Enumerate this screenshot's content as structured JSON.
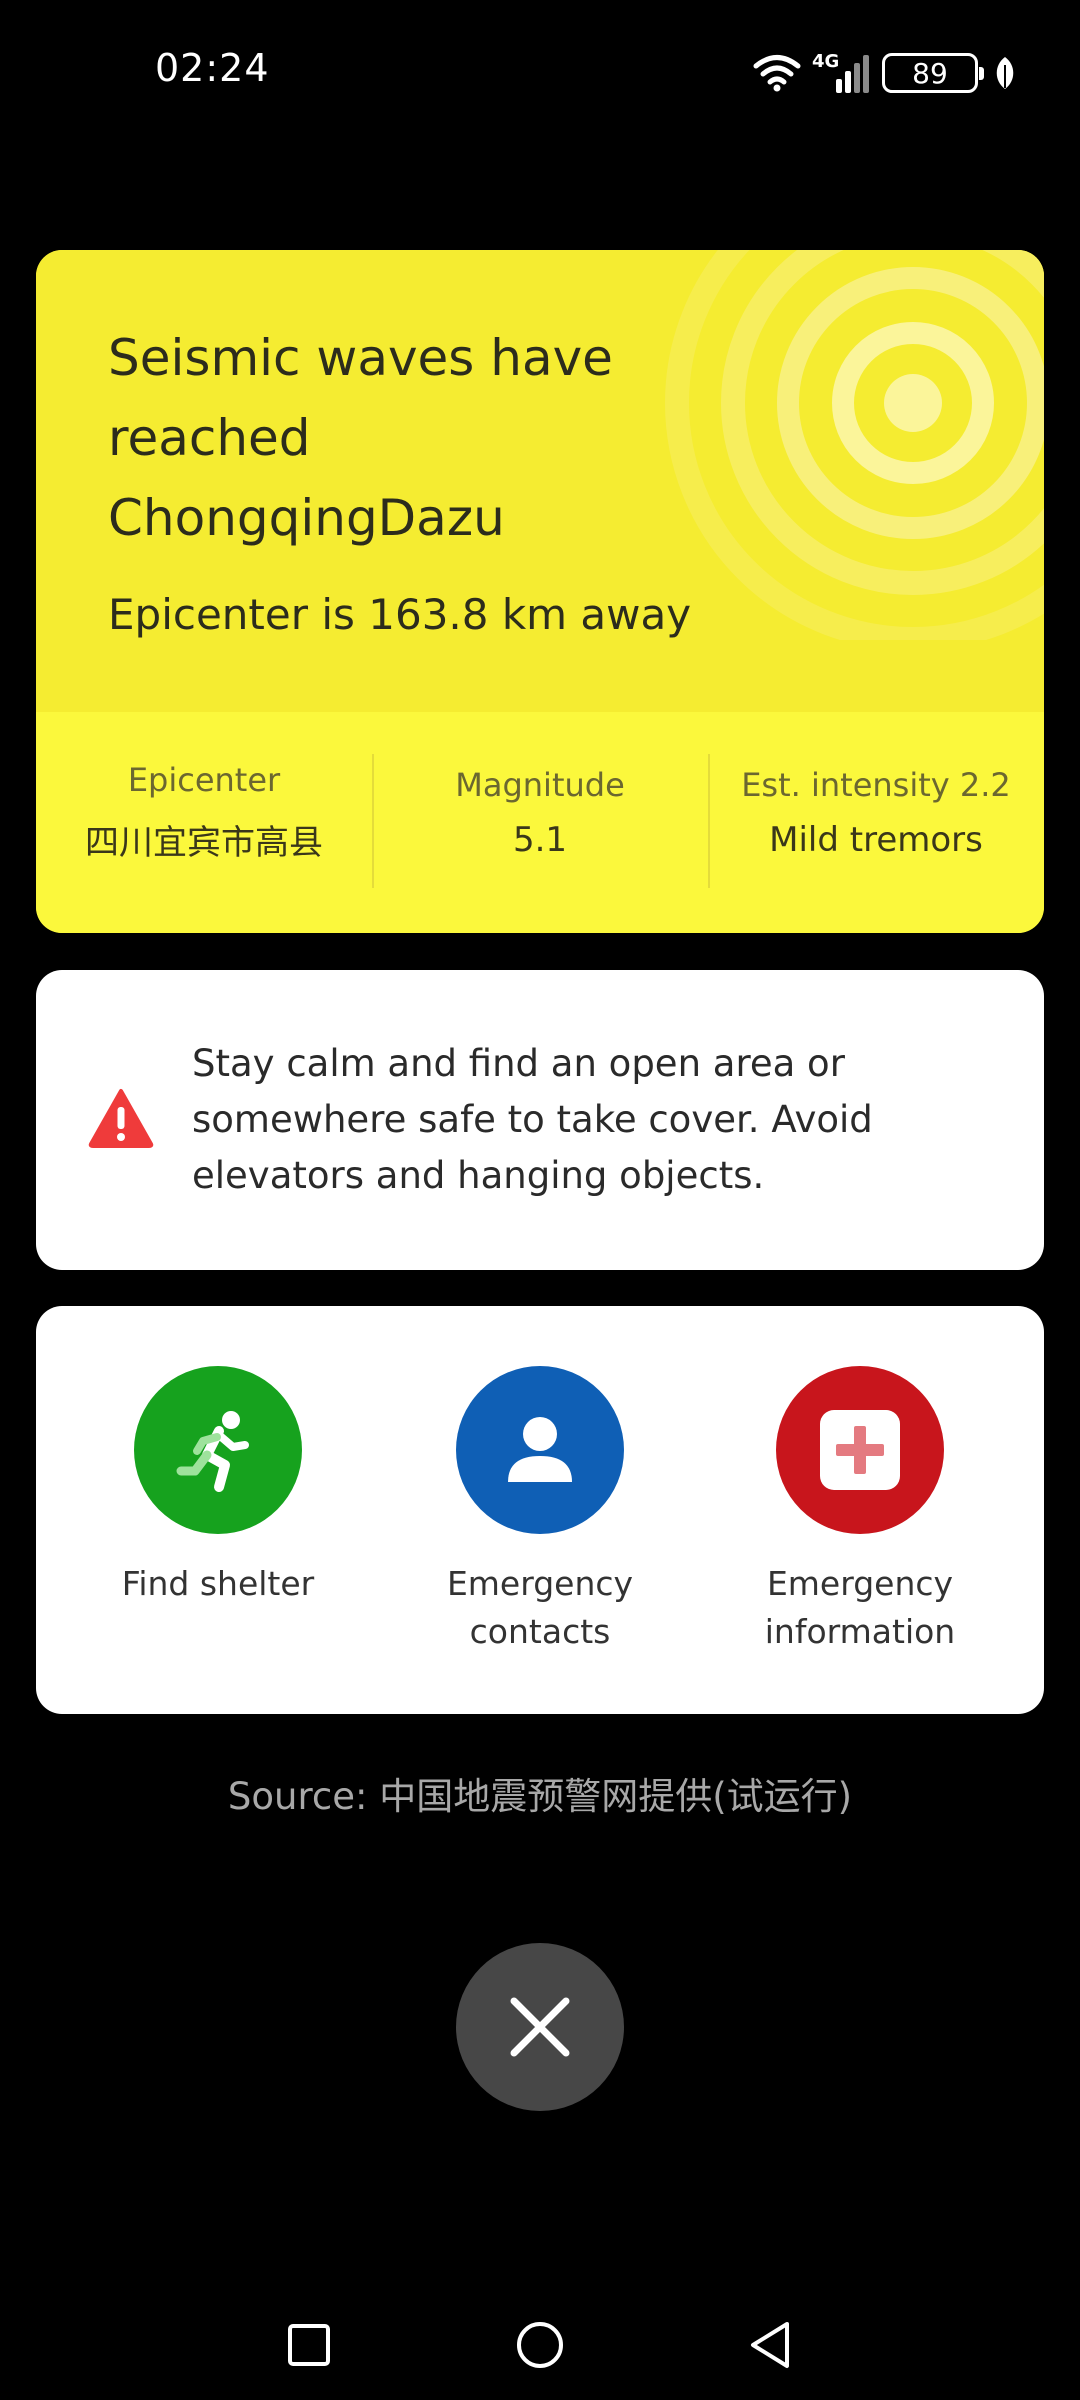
{
  "status_bar": {
    "time": "02:24",
    "network": "4G",
    "battery": "89"
  },
  "alert": {
    "title": "Seismic waves have\nreached\nChongqingDazu",
    "distance": "Epicenter is 163.8 km away",
    "background_color": "#f5ec31",
    "stats": [
      {
        "label": "Epicenter",
        "value": "四川宜宾市高县"
      },
      {
        "label": "Magnitude",
        "value": "5.1"
      },
      {
        "label": "Est. intensity 2.2",
        "value": "Mild tremors"
      }
    ]
  },
  "advice": {
    "icon": "warning-icon",
    "text": "Stay calm and find an open area or somewhere safe to take cover. Avoid elevators and hanging objects."
  },
  "actions": [
    {
      "label": "Find shelter",
      "icon": "running-person-icon",
      "color": "#16a21e"
    },
    {
      "label": "Emergency\ncontacts",
      "icon": "person-icon",
      "color": "#0f5fb5"
    },
    {
      "label": "Emergency\ninformation",
      "icon": "medical-cross-icon",
      "color": "#c8151c"
    }
  ],
  "source": "Source: 中国地震预警网提供(试运行)",
  "close": {
    "icon": "close-icon"
  },
  "nav": {
    "icons": [
      "recent-apps-icon",
      "home-icon",
      "back-icon"
    ]
  }
}
